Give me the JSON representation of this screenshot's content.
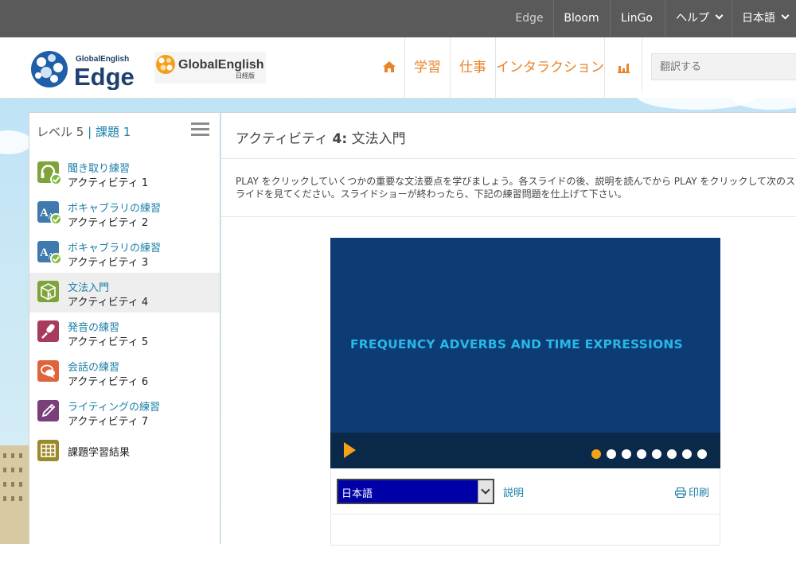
{
  "topbar": {
    "edge": "Edge",
    "bloom": "Bloom",
    "lingo": "LinGo",
    "help": "ヘルプ",
    "language": "日本語"
  },
  "header": {
    "logo_edge_small": "GlobalEnglish",
    "logo_edge_big": "Edge",
    "logo_ge": "GlobalEnglish",
    "logo_ge_sub": "日経版",
    "nav": {
      "study": "学習",
      "work": "仕事",
      "interaction": "インタラクション"
    },
    "search_placeholder": "翻訳する"
  },
  "sidebar": {
    "level_label": "レベル 5",
    "sep": "|",
    "lesson_label": "課題",
    "lesson_number": "1",
    "items": [
      {
        "title": "聞き取り練習",
        "sub": "アクティビティ 1",
        "icon": "headphones-icon",
        "color": "#7fa33a",
        "done": true
      },
      {
        "title": "ボキャブラリの練習",
        "sub": "アクティビティ 2",
        "icon": "vocabulary-icon",
        "color": "#3f79ad",
        "done": true
      },
      {
        "title": "ボキャブラリの練習",
        "sub": "アクティビティ 3",
        "icon": "vocabulary-icon",
        "color": "#3f79ad",
        "done": true
      },
      {
        "title": "文法入門",
        "sub": "アクティビティ 4",
        "icon": "grammar-cube-icon",
        "color": "#7fa33a",
        "done": false
      },
      {
        "title": "発音の練習",
        "sub": "アクティビティ 5",
        "icon": "microphone-icon",
        "color": "#a83a5b",
        "done": false
      },
      {
        "title": "会話の練習",
        "sub": "アクティビティ 6",
        "icon": "speech-bubble-icon",
        "color": "#e0643a",
        "done": false
      },
      {
        "title": "ライティングの練習",
        "sub": "アクティビティ 7",
        "icon": "pencil-icon",
        "color": "#7a3f7a",
        "done": false
      },
      {
        "title": "課題学習結果",
        "icon": "results-grid-icon",
        "color": "#9a8a2a"
      }
    ]
  },
  "main": {
    "title_prefix": "アクティビティ",
    "title_num": "4:",
    "title_name": "文法入門",
    "instructions": "PLAY をクリックしていくつかの重要な文法要点を学びましょう。各スライドの後、説明を読んでから PLAY をクリックして次のスライドを見てください。スライドショーが終わったら、下記の練習問題を仕上げて下さい。",
    "slide": {
      "heading": "FREQUENCY ADVERBS AND TIME EXPRESSIONS",
      "dot_count": 8,
      "current_dot": 1
    },
    "language_select": "日本語",
    "explanation_link": "説明",
    "print_link": "印刷"
  },
  "colors": {
    "accent_orange": "#e8852a",
    "link_blue": "#1a7fa8",
    "slide_bg": "#0c3c73",
    "slide_text": "#29b8e8",
    "play_orange": "#f4a21a"
  }
}
